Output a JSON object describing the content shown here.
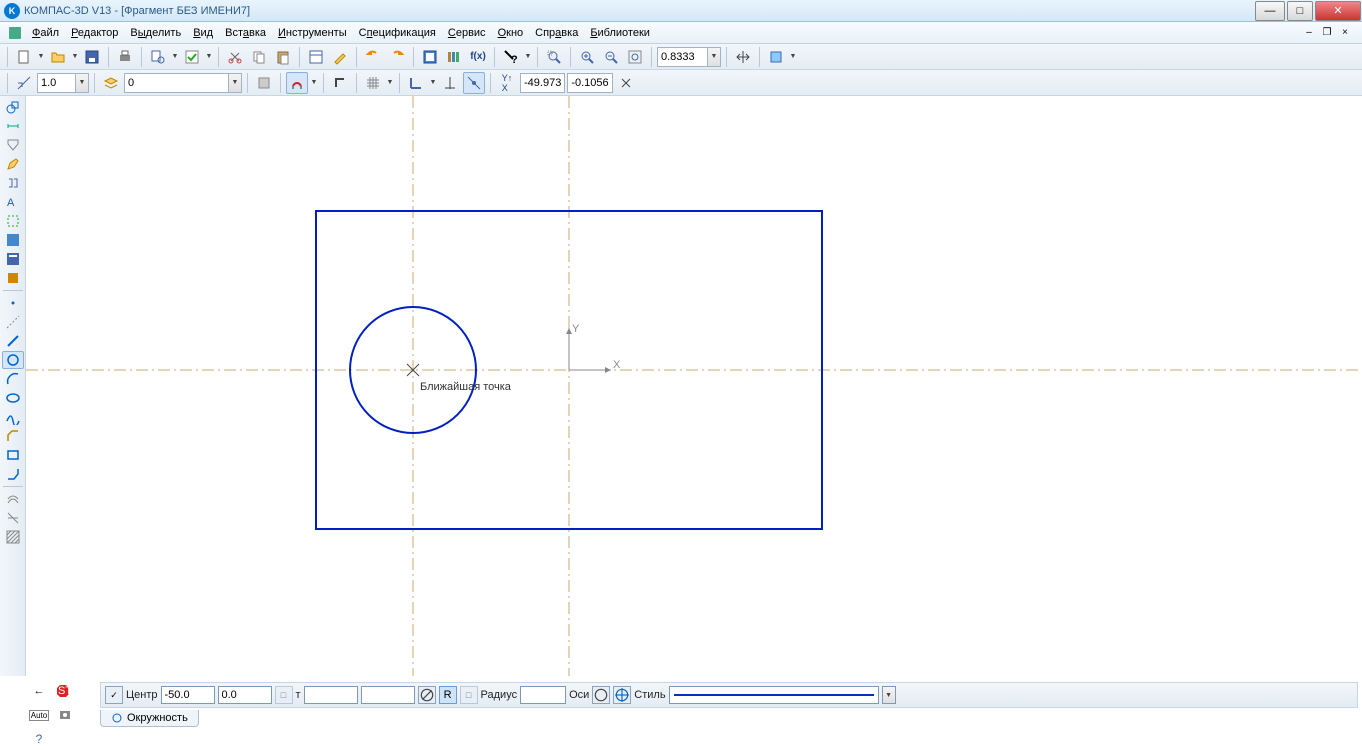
{
  "title": "КОМПАС-3D V13 - [Фрагмент БЕЗ ИМЕНИ7]",
  "menu": {
    "file": "Файл",
    "editor": "Редактор",
    "selection": "Выделить",
    "view": "Вид",
    "insert": "Вставка",
    "tools": "Инструменты",
    "spec": "Спецификация",
    "service": "Сервис",
    "window": "Окно",
    "help": "Справка",
    "libs": "Библиотеки"
  },
  "toolbar1": {
    "zoom_value": "0.8333"
  },
  "toolbar2": {
    "scale": "1.0",
    "layer": "0",
    "coord_x": "-49.973",
    "coord_y": "-0.1056"
  },
  "canvas": {
    "tooltip": "Ближайшая точка"
  },
  "props": {
    "center_label": "Центр",
    "cx": "-50.0",
    "cy": "0.0",
    "t_label": "т",
    "r_btn": "R",
    "radius_label": "Радиус",
    "axes_label": "Оси",
    "style_label": "Стиль"
  },
  "tab": {
    "name": "Окружность"
  }
}
